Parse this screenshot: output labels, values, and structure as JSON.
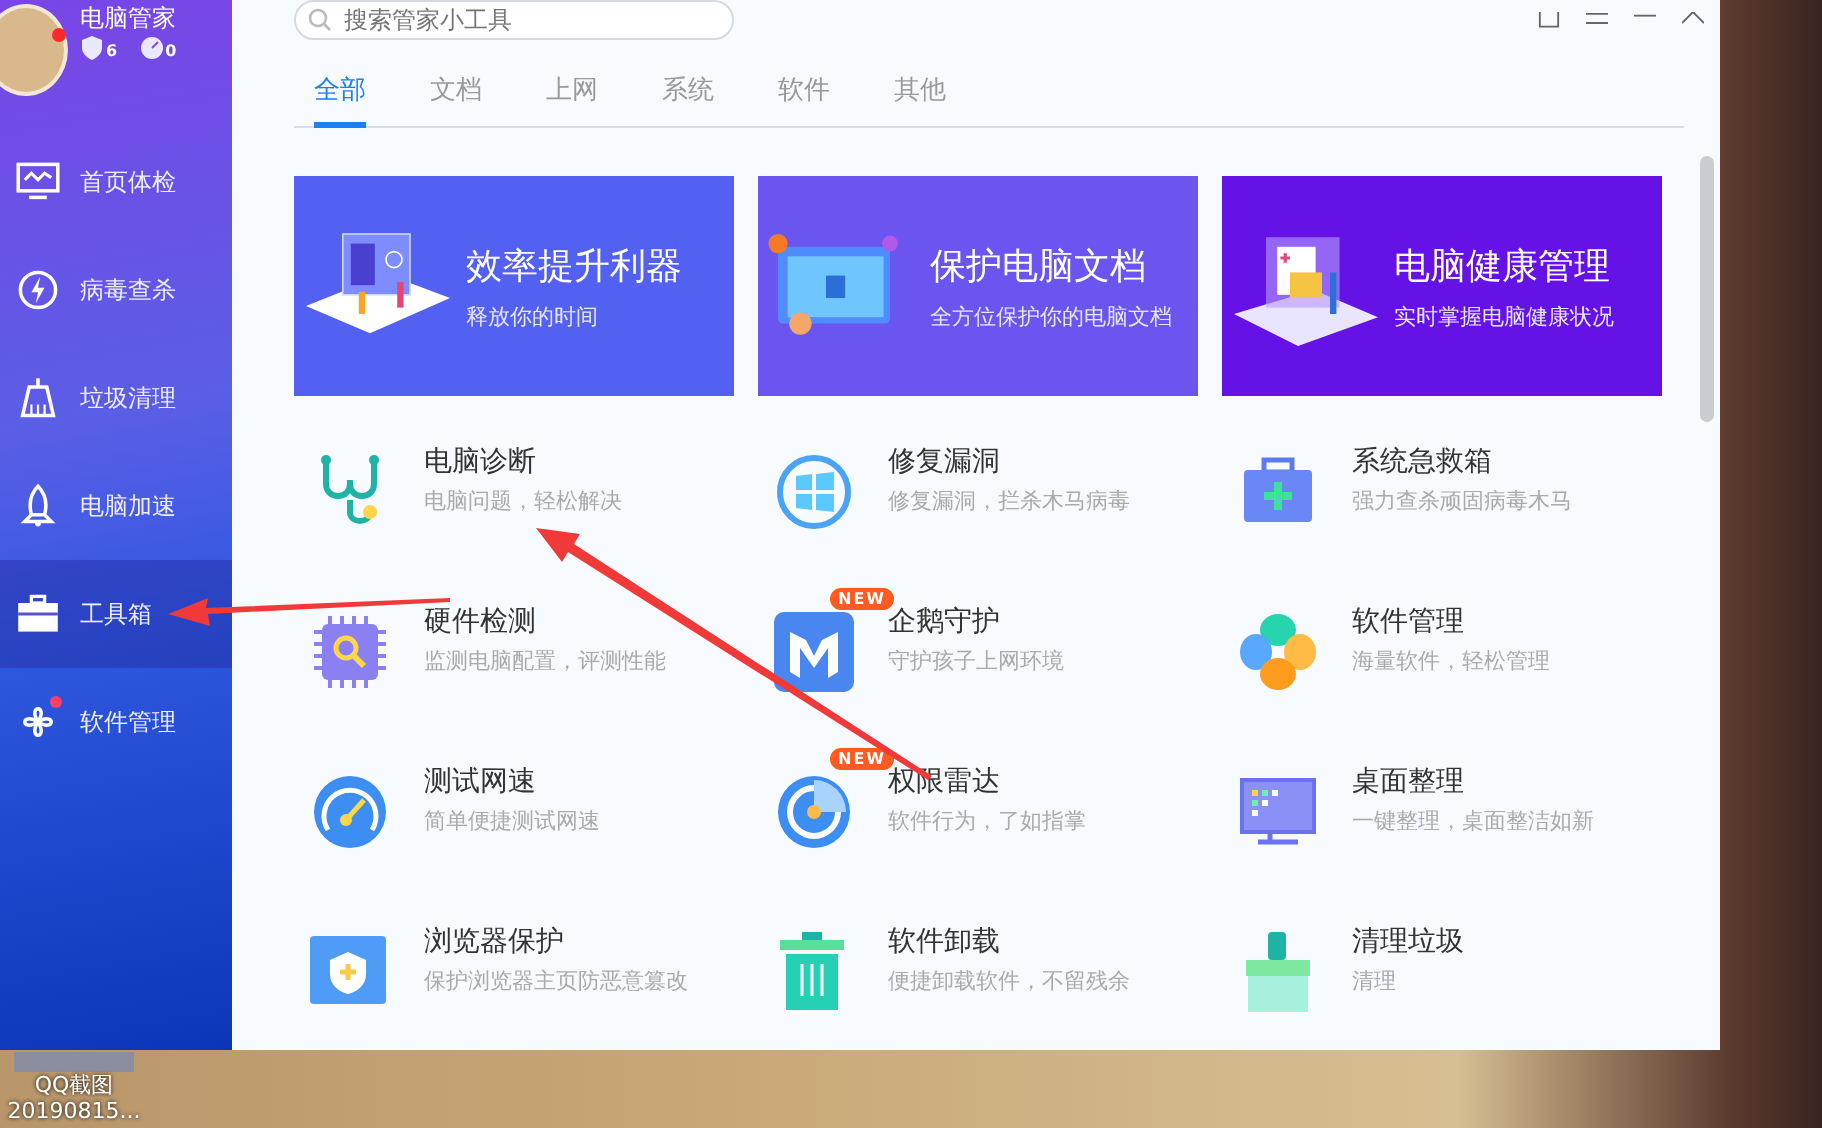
{
  "profile": {
    "title": "电脑管家",
    "notification": true,
    "counts": [
      "6",
      "0"
    ]
  },
  "sidebar": {
    "items": [
      {
        "label": "首页体检",
        "selected": false,
        "dot": false
      },
      {
        "label": "病毒查杀",
        "selected": false,
        "dot": false
      },
      {
        "label": "垃圾清理",
        "selected": false,
        "dot": false
      },
      {
        "label": "电脑加速",
        "selected": false,
        "dot": false
      },
      {
        "label": "工具箱",
        "selected": true,
        "dot": false
      },
      {
        "label": "软件管理",
        "selected": false,
        "dot": true
      }
    ]
  },
  "search": {
    "placeholder": "搜索管家小工具"
  },
  "tabs": [
    {
      "label": "全部",
      "selected": true
    },
    {
      "label": "文档",
      "selected": false
    },
    {
      "label": "上网",
      "selected": false
    },
    {
      "label": "系统",
      "selected": false
    },
    {
      "label": "软件",
      "selected": false
    },
    {
      "label": "其他",
      "selected": false
    }
  ],
  "banners": [
    {
      "title": "效率提升利器",
      "subtitle": "释放你的时间",
      "color": "#5361f2"
    },
    {
      "title": "保护电脑文档",
      "subtitle": "全方位保护你的电脑文档",
      "color": "#6a55f0"
    },
    {
      "title": "电脑健康管理",
      "subtitle": "实时掌握电脑健康状况",
      "color": "#6512e6"
    }
  ],
  "tools": [
    {
      "title": "电脑诊断",
      "subtitle": "电脑问题，轻松解决"
    },
    {
      "title": "修复漏洞",
      "subtitle": "修复漏洞，拦杀木马病毒"
    },
    {
      "title": "系统急救箱",
      "subtitle": "强力查杀顽固病毒木马"
    },
    {
      "title": "硬件检测",
      "subtitle": "监测电脑配置，评测性能"
    },
    {
      "title": "企鹅守护",
      "subtitle": "守护孩子上网环境",
      "badge": "NEW"
    },
    {
      "title": "软件管理",
      "subtitle": "海量软件，轻松管理"
    },
    {
      "title": "测试网速",
      "subtitle": "简单便捷测试网速"
    },
    {
      "title": "权限雷达",
      "subtitle": "软件行为，了如指掌",
      "badge": "NEW"
    },
    {
      "title": "桌面整理",
      "subtitle": "一键整理，桌面整洁如新"
    },
    {
      "title": "浏览器保护",
      "subtitle": "保护浏览器主页防恶意篡改"
    },
    {
      "title": "软件卸载",
      "subtitle": "便捷卸载软件，不留残余"
    },
    {
      "title": "清理垃圾",
      "subtitle": "清理"
    }
  ],
  "desktop_icon": {
    "label": "QQ截图",
    "sublabel": "20190815..."
  }
}
